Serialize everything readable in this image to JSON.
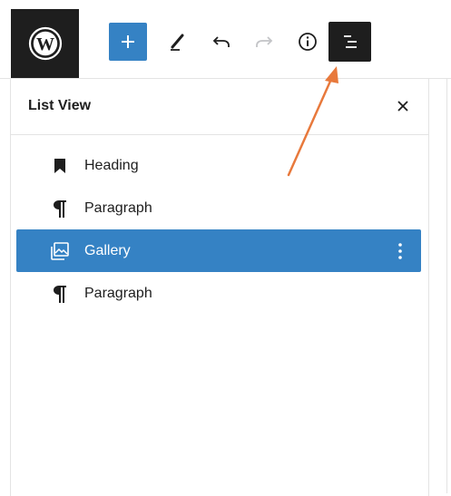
{
  "toolbar": {
    "logo_icon": "wordpress-logo-icon",
    "buttons": [
      {
        "icon": "plus-icon",
        "name": "add-block"
      },
      {
        "icon": "pencil-icon",
        "name": "tools"
      },
      {
        "icon": "undo-icon",
        "name": "undo"
      },
      {
        "icon": "redo-icon",
        "name": "redo"
      },
      {
        "icon": "info-icon",
        "name": "details"
      },
      {
        "icon": "list-view-icon",
        "name": "list-view"
      }
    ],
    "accent": "#3582c4",
    "dark": "#1e1e1e"
  },
  "panel": {
    "title": "List View",
    "close_icon": "close-icon"
  },
  "list": {
    "items": [
      {
        "label": "Heading",
        "icon": "bookmark-icon",
        "selected": false
      },
      {
        "label": "Paragraph",
        "icon": "pilcrow-icon",
        "selected": false
      },
      {
        "label": "Gallery",
        "icon": "gallery-icon",
        "selected": true
      },
      {
        "label": "Paragraph",
        "icon": "pilcrow-icon",
        "selected": false
      }
    ]
  },
  "annotation": {
    "arrow_color": "#e8793c"
  }
}
